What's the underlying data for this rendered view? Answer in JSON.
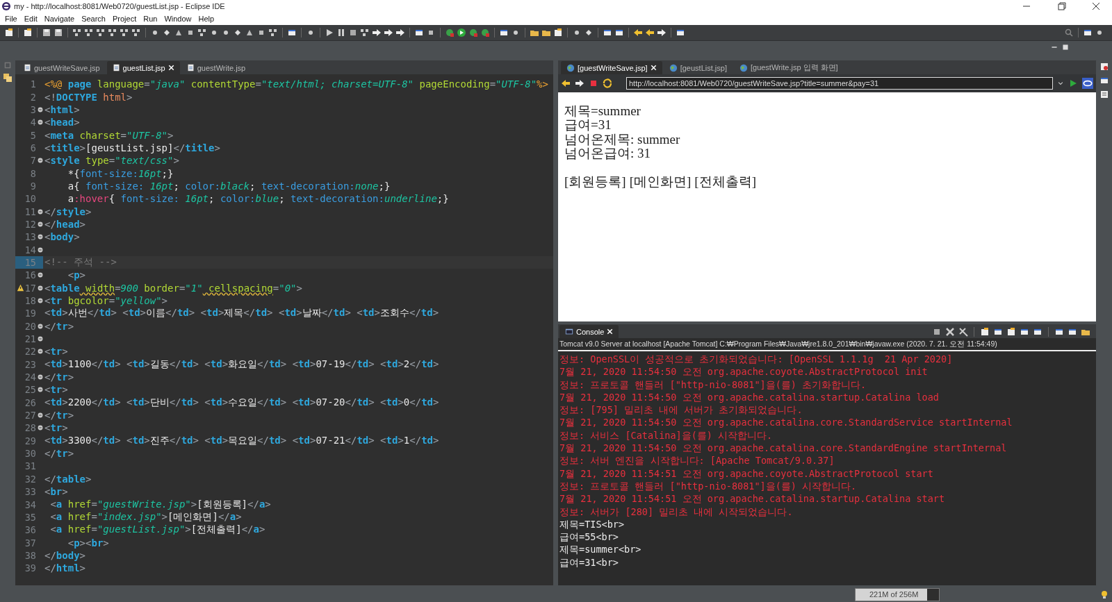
{
  "window": {
    "title": "my - http://localhost:8081/Web0720/guestList.jsp - Eclipse IDE"
  },
  "menu": [
    "File",
    "Edit",
    "Navigate",
    "Search",
    "Project",
    "Run",
    "Window",
    "Help"
  ],
  "editor": {
    "tabs": [
      {
        "label": "guestWriteSave.jsp",
        "selected": false
      },
      {
        "label": "guestList.jsp",
        "selected": true
      },
      {
        "label": "guestWrite.jsp",
        "selected": false
      }
    ],
    "lines": [
      {
        "number": "1",
        "fold": false,
        "warning": false,
        "current": false,
        "tokens": [
          {
            "kind": "d",
            "text": "<%@ "
          },
          {
            "kind": "t",
            "text": "page"
          },
          {
            "kind": "a",
            "text": " language"
          },
          {
            "kind": "p",
            "text": "="
          },
          {
            "kind": "v",
            "text": "\"java\""
          },
          {
            "kind": "a",
            "text": " contentType"
          },
          {
            "kind": "p",
            "text": "="
          },
          {
            "kind": "v",
            "text": "\"text/html; charset=UTF-8\""
          },
          {
            "kind": "a",
            "text": " pageEncoding"
          },
          {
            "kind": "p",
            "text": "="
          },
          {
            "kind": "v",
            "text": "\"UTF-8\""
          },
          {
            "kind": "d",
            "text": "%>"
          }
        ]
      },
      {
        "number": "2",
        "fold": false,
        "warning": false,
        "current": false,
        "tokens": [
          {
            "kind": "p",
            "text": "<!"
          },
          {
            "kind": "t",
            "text": "DOCTYPE"
          },
          {
            "kind": "h",
            "text": " html"
          },
          {
            "kind": "p",
            "text": ">"
          }
        ]
      },
      {
        "number": "3",
        "fold": true,
        "warning": false,
        "current": false,
        "tokens": [
          {
            "kind": "p",
            "text": "<"
          },
          {
            "kind": "t",
            "text": "html"
          },
          {
            "kind": "p",
            "text": ">"
          }
        ]
      },
      {
        "number": "4",
        "fold": true,
        "warning": false,
        "current": false,
        "tokens": [
          {
            "kind": "p",
            "text": "<"
          },
          {
            "kind": "t",
            "text": "head"
          },
          {
            "kind": "p",
            "text": ">"
          }
        ]
      },
      {
        "number": "5",
        "fold": false,
        "warning": false,
        "current": false,
        "tokens": [
          {
            "kind": "p",
            "text": "<"
          },
          {
            "kind": "t",
            "text": "meta"
          },
          {
            "kind": "a",
            "text": " charset"
          },
          {
            "kind": "p",
            "text": "="
          },
          {
            "kind": "v",
            "text": "\"UTF-8\""
          },
          {
            "kind": "p",
            "text": ">"
          }
        ]
      },
      {
        "number": "6",
        "fold": false,
        "warning": false,
        "current": false,
        "tokens": [
          {
            "kind": "p",
            "text": "<"
          },
          {
            "kind": "t",
            "text": "title"
          },
          {
            "kind": "p",
            "text": ">"
          },
          {
            "kind": "x",
            "text": "[geustList.jsp]"
          },
          {
            "kind": "p",
            "text": "</"
          },
          {
            "kind": "t",
            "text": "title"
          },
          {
            "kind": "p",
            "text": ">"
          }
        ]
      },
      {
        "number": "7",
        "fold": true,
        "warning": false,
        "current": false,
        "tokens": [
          {
            "kind": "p",
            "text": "<"
          },
          {
            "kind": "t",
            "text": "style"
          },
          {
            "kind": "a",
            "text": " type"
          },
          {
            "kind": "p",
            "text": "="
          },
          {
            "kind": "v",
            "text": "\"text/css\""
          },
          {
            "kind": "p",
            "text": ">"
          }
        ]
      },
      {
        "number": "8",
        "fold": false,
        "warning": false,
        "current": false,
        "tokens": [
          {
            "kind": "x",
            "text": "    *{"
          },
          {
            "kind": "s",
            "text": "font-size:"
          },
          {
            "kind": "y",
            "text": "16pt"
          },
          {
            "kind": "x",
            "text": ";}"
          }
        ]
      },
      {
        "number": "9",
        "fold": false,
        "warning": false,
        "current": false,
        "tokens": [
          {
            "kind": "x",
            "text": "    a{"
          },
          {
            "kind": "s",
            "text": " font-size: "
          },
          {
            "kind": "y",
            "text": "16pt"
          },
          {
            "kind": "x",
            "text": ";"
          },
          {
            "kind": "s",
            "text": " color:"
          },
          {
            "kind": "y",
            "text": "black"
          },
          {
            "kind": "x",
            "text": ";"
          },
          {
            "kind": "s",
            "text": " text-decoration:"
          },
          {
            "kind": "y",
            "text": "none"
          },
          {
            "kind": "x",
            "text": ";}"
          }
        ]
      },
      {
        "number": "10",
        "fold": false,
        "warning": false,
        "current": false,
        "tokens": [
          {
            "kind": "x",
            "text": "    a"
          },
          {
            "kind": "o",
            "text": ":hover"
          },
          {
            "kind": "x",
            "text": "{"
          },
          {
            "kind": "s",
            "text": " font-size: "
          },
          {
            "kind": "y",
            "text": "16pt"
          },
          {
            "kind": "x",
            "text": ";"
          },
          {
            "kind": "s",
            "text": " color:"
          },
          {
            "kind": "y",
            "text": "blue"
          },
          {
            "kind": "x",
            "text": ";"
          },
          {
            "kind": "s",
            "text": " text-decoration:"
          },
          {
            "kind": "y",
            "text": "underline"
          },
          {
            "kind": "x",
            "text": ";}"
          }
        ]
      },
      {
        "number": "11",
        "fold": true,
        "warning": false,
        "current": false,
        "tokens": [
          {
            "kind": "p",
            "text": "</"
          },
          {
            "kind": "t",
            "text": "style"
          },
          {
            "kind": "p",
            "text": ">"
          }
        ]
      },
      {
        "number": "12",
        "fold": true,
        "warning": false,
        "current": false,
        "tokens": [
          {
            "kind": "p",
            "text": "</"
          },
          {
            "kind": "t",
            "text": "head"
          },
          {
            "kind": "p",
            "text": ">"
          }
        ]
      },
      {
        "number": "13",
        "fold": true,
        "warning": false,
        "current": false,
        "tokens": [
          {
            "kind": "p",
            "text": "<"
          },
          {
            "kind": "t",
            "text": "body"
          },
          {
            "kind": "p",
            "text": ">"
          }
        ]
      },
      {
        "number": "14",
        "fold": true,
        "warning": false,
        "current": false
      },
      {
        "number": "15",
        "fold": false,
        "warning": false,
        "current": true,
        "tokens": [
          {
            "kind": "c",
            "text": "<!-- 주석 -->"
          }
        ]
      },
      {
        "number": "16",
        "fold": true,
        "warning": false,
        "current": false,
        "tokens": [
          {
            "kind": "p",
            "text": "    <"
          },
          {
            "kind": "t",
            "text": "p"
          },
          {
            "kind": "p",
            "text": ">"
          }
        ]
      },
      {
        "number": "17",
        "fold": true,
        "warning": true,
        "current": false,
        "tokens": [
          {
            "kind": "p",
            "text": "<"
          },
          {
            "kind": "t",
            "text": "table"
          },
          {
            "kind": "w",
            "text": " width"
          },
          {
            "kind": "p",
            "text": "="
          },
          {
            "kind": "v",
            "text": "900"
          },
          {
            "kind": "a",
            "text": " border"
          },
          {
            "kind": "p",
            "text": "="
          },
          {
            "kind": "v",
            "text": "\"1\""
          },
          {
            "kind": "w",
            "text": " cellspacing"
          },
          {
            "kind": "p",
            "text": "="
          },
          {
            "kind": "v",
            "text": "\"0\""
          },
          {
            "kind": "p",
            "text": ">"
          }
        ]
      },
      {
        "number": "18",
        "fold": true,
        "warning": false,
        "current": false,
        "tokens": [
          {
            "kind": "p",
            "text": "<"
          },
          {
            "kind": "t",
            "text": "tr"
          },
          {
            "kind": "a",
            "text": " bgcolor"
          },
          {
            "kind": "p",
            "text": "="
          },
          {
            "kind": "v",
            "text": "\"yellow\""
          },
          {
            "kind": "p",
            "text": ">"
          }
        ]
      },
      {
        "number": "19",
        "fold": false,
        "warning": false,
        "current": false,
        "tokens": [
          {
            "kind": "p",
            "text": "<"
          },
          {
            "kind": "t",
            "text": "td"
          },
          {
            "kind": "p",
            "text": ">"
          },
          {
            "kind": "x",
            "text": "사번"
          },
          {
            "kind": "p",
            "text": "</"
          },
          {
            "kind": "t",
            "text": "td"
          },
          {
            "kind": "p",
            "text": "> <"
          },
          {
            "kind": "t",
            "text": "td"
          },
          {
            "kind": "p",
            "text": ">"
          },
          {
            "kind": "x",
            "text": "이름"
          },
          {
            "kind": "p",
            "text": "</"
          },
          {
            "kind": "t",
            "text": "td"
          },
          {
            "kind": "p",
            "text": "> <"
          },
          {
            "kind": "t",
            "text": "td"
          },
          {
            "kind": "p",
            "text": ">"
          },
          {
            "kind": "x",
            "text": "제목"
          },
          {
            "kind": "p",
            "text": "</"
          },
          {
            "kind": "t",
            "text": "td"
          },
          {
            "kind": "p",
            "text": "> <"
          },
          {
            "kind": "t",
            "text": "td"
          },
          {
            "kind": "p",
            "text": ">"
          },
          {
            "kind": "x",
            "text": "날짜"
          },
          {
            "kind": "p",
            "text": "</"
          },
          {
            "kind": "t",
            "text": "td"
          },
          {
            "kind": "p",
            "text": "> <"
          },
          {
            "kind": "t",
            "text": "td"
          },
          {
            "kind": "p",
            "text": ">"
          },
          {
            "kind": "x",
            "text": "조회수"
          },
          {
            "kind": "p",
            "text": "</"
          },
          {
            "kind": "t",
            "text": "td"
          },
          {
            "kind": "p",
            "text": ">"
          }
        ]
      },
      {
        "number": "20",
        "fold": true,
        "warning": false,
        "current": false,
        "tokens": [
          {
            "kind": "p",
            "text": "</"
          },
          {
            "kind": "t",
            "text": "tr"
          },
          {
            "kind": "p",
            "text": ">"
          }
        ]
      },
      {
        "number": "21",
        "fold": true,
        "warning": false,
        "current": false
      },
      {
        "number": "22",
        "fold": true,
        "warning": false,
        "current": false,
        "tokens": [
          {
            "kind": "p",
            "text": "<"
          },
          {
            "kind": "t",
            "text": "tr"
          },
          {
            "kind": "p",
            "text": ">"
          }
        ]
      },
      {
        "number": "23",
        "fold": false,
        "warning": false,
        "current": false,
        "tokens": [
          {
            "kind": "p",
            "text": "<"
          },
          {
            "kind": "t",
            "text": "td"
          },
          {
            "kind": "p",
            "text": ">"
          },
          {
            "kind": "x",
            "text": "1100"
          },
          {
            "kind": "p",
            "text": "</"
          },
          {
            "kind": "t",
            "text": "td"
          },
          {
            "kind": "p",
            "text": "> <"
          },
          {
            "kind": "t",
            "text": "td"
          },
          {
            "kind": "p",
            "text": ">"
          },
          {
            "kind": "x",
            "text": "길동"
          },
          {
            "kind": "p",
            "text": "</"
          },
          {
            "kind": "t",
            "text": "td"
          },
          {
            "kind": "p",
            "text": "> <"
          },
          {
            "kind": "t",
            "text": "td"
          },
          {
            "kind": "p",
            "text": ">"
          },
          {
            "kind": "x",
            "text": "화요일"
          },
          {
            "kind": "p",
            "text": "</"
          },
          {
            "kind": "t",
            "text": "td"
          },
          {
            "kind": "p",
            "text": "> <"
          },
          {
            "kind": "t",
            "text": "td"
          },
          {
            "kind": "p",
            "text": ">"
          },
          {
            "kind": "x",
            "text": "07-19"
          },
          {
            "kind": "p",
            "text": "</"
          },
          {
            "kind": "t",
            "text": "td"
          },
          {
            "kind": "p",
            "text": "> <"
          },
          {
            "kind": "t",
            "text": "td"
          },
          {
            "kind": "p",
            "text": ">"
          },
          {
            "kind": "x",
            "text": "2"
          },
          {
            "kind": "p",
            "text": "</"
          },
          {
            "kind": "t",
            "text": "td"
          },
          {
            "kind": "p",
            "text": ">"
          }
        ]
      },
      {
        "number": "24",
        "fold": true,
        "warning": false,
        "current": false,
        "tokens": [
          {
            "kind": "p",
            "text": "</"
          },
          {
            "kind": "t",
            "text": "tr"
          },
          {
            "kind": "p",
            "text": ">"
          }
        ]
      },
      {
        "number": "25",
        "fold": true,
        "warning": false,
        "current": false,
        "tokens": [
          {
            "kind": "p",
            "text": "<"
          },
          {
            "kind": "t",
            "text": "tr"
          },
          {
            "kind": "p",
            "text": ">"
          }
        ]
      },
      {
        "number": "26",
        "fold": false,
        "warning": false,
        "current": false,
        "tokens": [
          {
            "kind": "p",
            "text": "<"
          },
          {
            "kind": "t",
            "text": "td"
          },
          {
            "kind": "p",
            "text": ">"
          },
          {
            "kind": "x",
            "text": "2200"
          },
          {
            "kind": "p",
            "text": "</"
          },
          {
            "kind": "t",
            "text": "td"
          },
          {
            "kind": "p",
            "text": "> <"
          },
          {
            "kind": "t",
            "text": "td"
          },
          {
            "kind": "p",
            "text": ">"
          },
          {
            "kind": "x",
            "text": "단비"
          },
          {
            "kind": "p",
            "text": "</"
          },
          {
            "kind": "t",
            "text": "td"
          },
          {
            "kind": "p",
            "text": "> <"
          },
          {
            "kind": "t",
            "text": "td"
          },
          {
            "kind": "p",
            "text": ">"
          },
          {
            "kind": "x",
            "text": "수요일"
          },
          {
            "kind": "p",
            "text": "</"
          },
          {
            "kind": "t",
            "text": "td"
          },
          {
            "kind": "p",
            "text": "> <"
          },
          {
            "kind": "t",
            "text": "td"
          },
          {
            "kind": "p",
            "text": ">"
          },
          {
            "kind": "x",
            "text": "07-20"
          },
          {
            "kind": "p",
            "text": "</"
          },
          {
            "kind": "t",
            "text": "td"
          },
          {
            "kind": "p",
            "text": "> <"
          },
          {
            "kind": "t",
            "text": "td"
          },
          {
            "kind": "p",
            "text": ">"
          },
          {
            "kind": "x",
            "text": "0"
          },
          {
            "kind": "p",
            "text": "</"
          },
          {
            "kind": "t",
            "text": "td"
          },
          {
            "kind": "p",
            "text": ">"
          }
        ]
      },
      {
        "number": "27",
        "fold": true,
        "warning": false,
        "current": false,
        "tokens": [
          {
            "kind": "p",
            "text": "</"
          },
          {
            "kind": "t",
            "text": "tr"
          },
          {
            "kind": "p",
            "text": ">"
          }
        ]
      },
      {
        "number": "28",
        "fold": true,
        "warning": false,
        "current": false,
        "tokens": [
          {
            "kind": "p",
            "text": "<"
          },
          {
            "kind": "t",
            "text": "tr"
          },
          {
            "kind": "p",
            "text": ">"
          }
        ]
      },
      {
        "number": "29",
        "fold": false,
        "warning": false,
        "current": false,
        "tokens": [
          {
            "kind": "p",
            "text": "<"
          },
          {
            "kind": "t",
            "text": "td"
          },
          {
            "kind": "p",
            "text": ">"
          },
          {
            "kind": "x",
            "text": "3300"
          },
          {
            "kind": "p",
            "text": "</"
          },
          {
            "kind": "t",
            "text": "td"
          },
          {
            "kind": "p",
            "text": "> <"
          },
          {
            "kind": "t",
            "text": "td"
          },
          {
            "kind": "p",
            "text": ">"
          },
          {
            "kind": "x",
            "text": "진주"
          },
          {
            "kind": "p",
            "text": "</"
          },
          {
            "kind": "t",
            "text": "td"
          },
          {
            "kind": "p",
            "text": "> <"
          },
          {
            "kind": "t",
            "text": "td"
          },
          {
            "kind": "p",
            "text": ">"
          },
          {
            "kind": "x",
            "text": "목요일"
          },
          {
            "kind": "p",
            "text": "</"
          },
          {
            "kind": "t",
            "text": "td"
          },
          {
            "kind": "p",
            "text": "> <"
          },
          {
            "kind": "t",
            "text": "td"
          },
          {
            "kind": "p",
            "text": ">"
          },
          {
            "kind": "x",
            "text": "07-21"
          },
          {
            "kind": "p",
            "text": "</"
          },
          {
            "kind": "t",
            "text": "td"
          },
          {
            "kind": "p",
            "text": "> <"
          },
          {
            "kind": "t",
            "text": "td"
          },
          {
            "kind": "p",
            "text": ">"
          },
          {
            "kind": "x",
            "text": "1"
          },
          {
            "kind": "p",
            "text": "</"
          },
          {
            "kind": "t",
            "text": "td"
          },
          {
            "kind": "p",
            "text": ">"
          }
        ]
      },
      {
        "number": "30",
        "fold": false,
        "warning": false,
        "current": false,
        "tokens": [
          {
            "kind": "p",
            "text": "</"
          },
          {
            "kind": "t",
            "text": "tr"
          },
          {
            "kind": "p",
            "text": ">"
          }
        ]
      },
      {
        "number": "31",
        "fold": false,
        "warning": false,
        "current": false
      },
      {
        "number": "32",
        "fold": false,
        "warning": false,
        "current": false,
        "tokens": [
          {
            "kind": "p",
            "text": "</"
          },
          {
            "kind": "t",
            "text": "table"
          },
          {
            "kind": "p",
            "text": ">"
          }
        ]
      },
      {
        "number": "33",
        "fold": false,
        "warning": false,
        "current": false,
        "tokens": [
          {
            "kind": "p",
            "text": "<"
          },
          {
            "kind": "t",
            "text": "br"
          },
          {
            "kind": "p",
            "text": ">"
          }
        ]
      },
      {
        "number": "34",
        "fold": false,
        "warning": false,
        "current": false,
        "tokens": [
          {
            "kind": "p",
            "text": " <"
          },
          {
            "kind": "t",
            "text": "a"
          },
          {
            "kind": "a",
            "text": " href"
          },
          {
            "kind": "p",
            "text": "="
          },
          {
            "kind": "v",
            "text": "\"guestWrite.jsp\""
          },
          {
            "kind": "p",
            "text": ">"
          },
          {
            "kind": "x",
            "text": "[회원등록]"
          },
          {
            "kind": "p",
            "text": "</"
          },
          {
            "kind": "t",
            "text": "a"
          },
          {
            "kind": "p",
            "text": ">"
          }
        ]
      },
      {
        "number": "35",
        "fold": false,
        "warning": false,
        "current": false,
        "tokens": [
          {
            "kind": "p",
            "text": " <"
          },
          {
            "kind": "t",
            "text": "a"
          },
          {
            "kind": "a",
            "text": " href"
          },
          {
            "kind": "p",
            "text": "="
          },
          {
            "kind": "v",
            "text": "\"index.jsp\""
          },
          {
            "kind": "p",
            "text": ">"
          },
          {
            "kind": "x",
            "text": "[메인화면]"
          },
          {
            "kind": "p",
            "text": "</"
          },
          {
            "kind": "t",
            "text": "a"
          },
          {
            "kind": "p",
            "text": ">"
          }
        ]
      },
      {
        "number": "36",
        "fold": false,
        "warning": false,
        "current": false,
        "tokens": [
          {
            "kind": "p",
            "text": " <"
          },
          {
            "kind": "t",
            "text": "a"
          },
          {
            "kind": "a",
            "text": " href"
          },
          {
            "kind": "p",
            "text": "="
          },
          {
            "kind": "v",
            "text": "\"guestList.jsp\""
          },
          {
            "kind": "p",
            "text": ">"
          },
          {
            "kind": "x",
            "text": "[전체출력]"
          },
          {
            "kind": "p",
            "text": "</"
          },
          {
            "kind": "t",
            "text": "a"
          },
          {
            "kind": "p",
            "text": ">"
          }
        ]
      },
      {
        "number": "37",
        "fold": false,
        "warning": false,
        "current": false,
        "tokens": [
          {
            "kind": "p",
            "text": "    <"
          },
          {
            "kind": "t",
            "text": "p"
          },
          {
            "kind": "p",
            "text": "><"
          },
          {
            "kind": "t",
            "text": "br"
          },
          {
            "kind": "p",
            "text": ">"
          }
        ]
      },
      {
        "number": "38",
        "fold": false,
        "warning": false,
        "current": false,
        "tokens": [
          {
            "kind": "p",
            "text": "</"
          },
          {
            "kind": "t",
            "text": "body"
          },
          {
            "kind": "p",
            "text": ">"
          }
        ]
      },
      {
        "number": "39",
        "fold": false,
        "warning": false,
        "current": false,
        "tokens": [
          {
            "kind": "p",
            "text": "</"
          },
          {
            "kind": "t",
            "text": "html"
          },
          {
            "kind": "p",
            "text": ">"
          }
        ]
      }
    ]
  },
  "browser": {
    "tabs": [
      {
        "label": "[guestWriteSave.jsp]",
        "selected": true
      },
      {
        "label": "[geustList.jsp]",
        "selected": false
      },
      {
        "label": "[guestWrite.jsp 입력 화면]",
        "selected": false
      }
    ],
    "url": "http://localhost:8081/Web0720/guestWriteSave.jsp?title=summer&pay=31",
    "lines": [
      "제목=summer",
      "급여=31",
      "넘어온제목: summer",
      "넘어온급여: 31"
    ],
    "links": [
      "[회원등록]",
      "[메인화면]",
      "[전체출력]"
    ]
  },
  "console": {
    "tab": "Console",
    "header": "Tomcat v9.0 Server at localhost [Apache Tomcat] C:₩Program Files₩Java₩jre1.8.0_201₩bin₩javaw.exe (2020. 7. 21. 오전 11:54:49)",
    "lines": [
      {
        "kind": "err",
        "text": "정보: OpenSSL이 성공적으로 초기화되었습니다: [OpenSSL 1.1.1g  21 Apr 2020]"
      },
      {
        "kind": "err",
        "text": "7월 21, 2020 11:54:50 오전 org.apache.coyote.AbstractProtocol init"
      },
      {
        "kind": "err",
        "text": "정보: 프로토콜 핸들러 [\"http-nio-8081\"]을(를) 초기화합니다."
      },
      {
        "kind": "err",
        "text": "7월 21, 2020 11:54:50 오전 org.apache.catalina.startup.Catalina load"
      },
      {
        "kind": "err",
        "text": "정보: [795] 밀리초 내에 서버가 초기화되었습니다."
      },
      {
        "kind": "err",
        "text": "7월 21, 2020 11:54:50 오전 org.apache.catalina.core.StandardService startInternal"
      },
      {
        "kind": "err",
        "text": "정보: 서비스 [Catalina]을(를) 시작합니다."
      },
      {
        "kind": "err",
        "text": "7월 21, 2020 11:54:50 오전 org.apache.catalina.core.StandardEngine startInternal"
      },
      {
        "kind": "err",
        "text": "정보: 서버 엔진을 시작합니다: [Apache Tomcat/9.0.37]"
      },
      {
        "kind": "err",
        "text": "7월 21, 2020 11:54:51 오전 org.apache.coyote.AbstractProtocol start"
      },
      {
        "kind": "err",
        "text": "정보: 프로토콜 핸들러 [\"http-nio-8081\"]을(를) 시작합니다."
      },
      {
        "kind": "err",
        "text": "7월 21, 2020 11:54:51 오전 org.apache.catalina.startup.Catalina start"
      },
      {
        "kind": "err",
        "text": "정보: 서버가 [280] 밀리초 내에 시작되었습니다."
      },
      {
        "kind": "out",
        "text": "제목=TIS<br>"
      },
      {
        "kind": "out",
        "text": "급여=55<br>"
      },
      {
        "kind": "out",
        "text": "제목=summer<br>"
      },
      {
        "kind": "out",
        "text": "급여=31<br>"
      }
    ]
  },
  "status": {
    "memory": "221M of 256M",
    "level": 0.86
  }
}
